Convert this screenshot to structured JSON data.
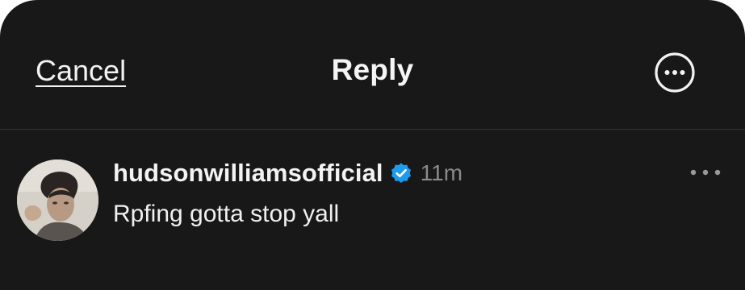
{
  "header": {
    "cancel_label": "Cancel",
    "title": "Reply",
    "more_icon": "more-circle-icon"
  },
  "post": {
    "username": "hudsonwilliamsofficial",
    "verified": true,
    "verified_icon": "verified-badge-icon",
    "time": "11m",
    "text": "Rpfing gotta stop yall",
    "more_icon": "more-horizontal-icon"
  },
  "colors": {
    "background": "#181818",
    "text": "#f3f3f3",
    "muted": "#8a8a8a",
    "verified": "#1d9bf0",
    "divider": "#333333"
  }
}
